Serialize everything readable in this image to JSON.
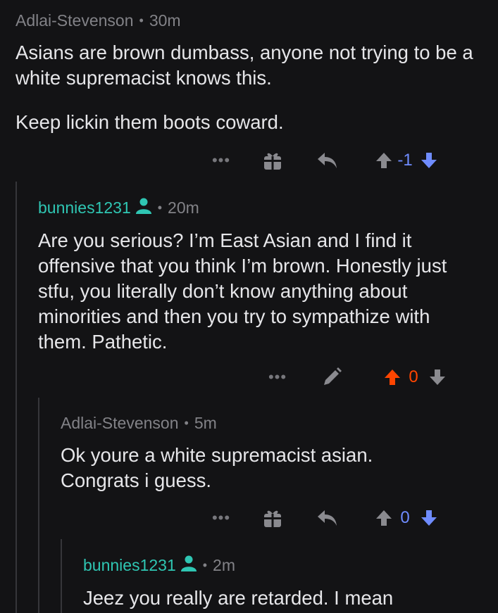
{
  "colors": {
    "background": "#131315",
    "op_accent": "#2fc6b3",
    "upvote_active": "#ff4500",
    "downvote_active": "#6f8cff",
    "icon_gray": "#8a8a8f"
  },
  "comments": [
    {
      "author": "Adlai-Stevenson",
      "time": "30m",
      "paragraphs": [
        "Asians are brown dumbass, anyone not trying to be a white supremacist knows this.",
        "Keep lickin them boots coward."
      ],
      "score": "-1",
      "vote_state": "downvoted",
      "icons": [
        "more-icon",
        "gift-icon",
        "reply-icon",
        "upvote-icon",
        "downvote-icon"
      ]
    },
    {
      "author": "bunnies1231",
      "is_op": true,
      "time": "20m",
      "paragraphs": [
        "Are you serious? I’m East Asian and I find it offensive that you think I’m brown. Honestly just stfu, you literally don’t know anything about minorities and then you try to sympathize with them. Pathetic."
      ],
      "score": "0",
      "vote_state": "upvoted",
      "icons": [
        "more-icon",
        "edit-icon",
        "upvote-icon",
        "downvote-icon"
      ]
    },
    {
      "author": "Adlai-Stevenson",
      "time": "5m",
      "paragraphs": [
        "Ok youre a white supremacist asian. Congrats i guess."
      ],
      "score": "0",
      "vote_state": "downvoted",
      "icons": [
        "more-icon",
        "gift-icon",
        "reply-icon",
        "upvote-icon",
        "downvote-icon"
      ]
    },
    {
      "author": "bunnies1231",
      "is_op": true,
      "time": "2m",
      "paragraphs": [
        "Jeez you really are retarded. I mean"
      ]
    }
  ],
  "more_label": "•••",
  "separator": "•"
}
